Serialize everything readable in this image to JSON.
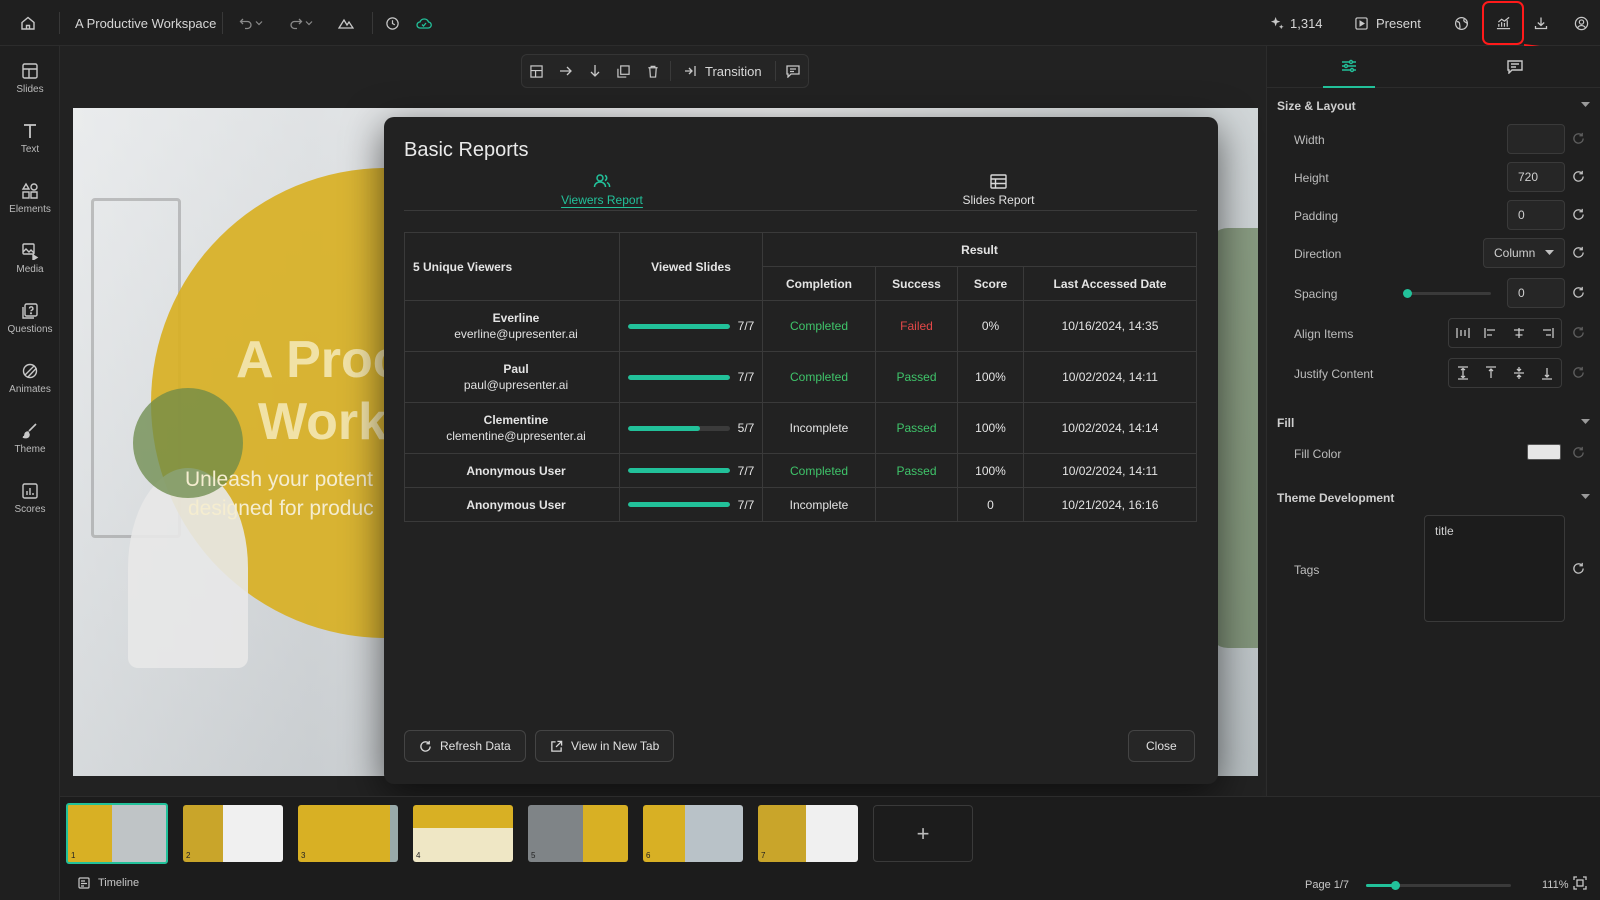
{
  "topbar": {
    "title": "A Productive Workspace",
    "credits": "1,314",
    "present_label": "Present"
  },
  "toolbar": {
    "transition_label": "Transition"
  },
  "sidebar": {
    "items": [
      {
        "label": "Slides",
        "icon": "slides-icon"
      },
      {
        "label": "Text",
        "icon": "text-icon"
      },
      {
        "label": "Elements",
        "icon": "elements-icon"
      },
      {
        "label": "Media",
        "icon": "media-icon"
      },
      {
        "label": "Questions",
        "icon": "questions-icon"
      },
      {
        "label": "Animates",
        "icon": "animates-icon"
      },
      {
        "label": "Theme",
        "icon": "theme-icon"
      },
      {
        "label": "Scores",
        "icon": "scores-icon"
      }
    ]
  },
  "slide": {
    "title_line1": "A Proc",
    "title_line2": "Work",
    "subtitle_line1": "Unleash your potent",
    "subtitle_line2": "designed for produc"
  },
  "modal": {
    "title": "Basic Reports",
    "tabs": [
      {
        "label": "Viewers Report",
        "active": true
      },
      {
        "label": "Slides Report",
        "active": false
      }
    ],
    "table": {
      "col_viewers": "5 Unique Viewers",
      "col_viewed": "Viewed Slides",
      "col_result": "Result",
      "col_completion": "Completion",
      "col_success": "Success",
      "col_score": "Score",
      "col_last": "Last Accessed Date",
      "rows": [
        {
          "name": "Everline",
          "email": "everline@upresenter.ai",
          "viewed": "7/7",
          "progress": 1.0,
          "completion": "Completed",
          "success": "Failed",
          "score": "0%",
          "last": "10/16/2024, 14:35"
        },
        {
          "name": "Paul",
          "email": "paul@upresenter.ai",
          "viewed": "7/7",
          "progress": 1.0,
          "completion": "Completed",
          "success": "Passed",
          "score": "100%",
          "last": "10/02/2024, 14:11"
        },
        {
          "name": "Clementine",
          "email": "clementine@upresenter.ai",
          "viewed": "5/7",
          "progress": 0.714,
          "completion": "Incomplete",
          "success": "Passed",
          "score": "100%",
          "last": "10/02/2024, 14:14"
        },
        {
          "name": "Anonymous User",
          "email": "",
          "viewed": "7/7",
          "progress": 1.0,
          "completion": "Completed",
          "success": "Passed",
          "score": "100%",
          "last": "10/02/2024, 14:11"
        },
        {
          "name": "Anonymous User",
          "email": "",
          "viewed": "7/7",
          "progress": 1.0,
          "completion": "Incomplete",
          "success": "",
          "score": "0",
          "last": "10/21/2024, 16:16"
        }
      ]
    },
    "refresh_label": "Refresh Data",
    "newtab_label": "View in New Tab",
    "close_label": "Close"
  },
  "rightpanel": {
    "section_size": "Size & Layout",
    "width_label": "Width",
    "width_value": "",
    "height_label": "Height",
    "height_value": "720",
    "padding_label": "Padding",
    "padding_value": "0",
    "direction_label": "Direction",
    "direction_value": "Column",
    "spacing_label": "Spacing",
    "spacing_value": "0",
    "align_label": "Align Items",
    "justify_label": "Justify Content",
    "section_fill": "Fill",
    "fill_color_label": "Fill Color",
    "fill_color": "#e6e6e6",
    "section_theme": "Theme Development",
    "tags_label": "Tags",
    "tags_value": "title"
  },
  "filmstrip": {
    "slides": [
      "1",
      "2",
      "3",
      "4",
      "5",
      "6",
      "7"
    ],
    "add_label": "+",
    "timeline_label": "Timeline",
    "page_label": "Page 1/7",
    "zoom_label": "111%",
    "zoom_level": 0.2
  },
  "colors": {
    "accent": "#22c19a",
    "gold": "#d8b024",
    "passed": "#3fc46a",
    "failed": "#e34848",
    "highlight": "#ff1a1a"
  }
}
